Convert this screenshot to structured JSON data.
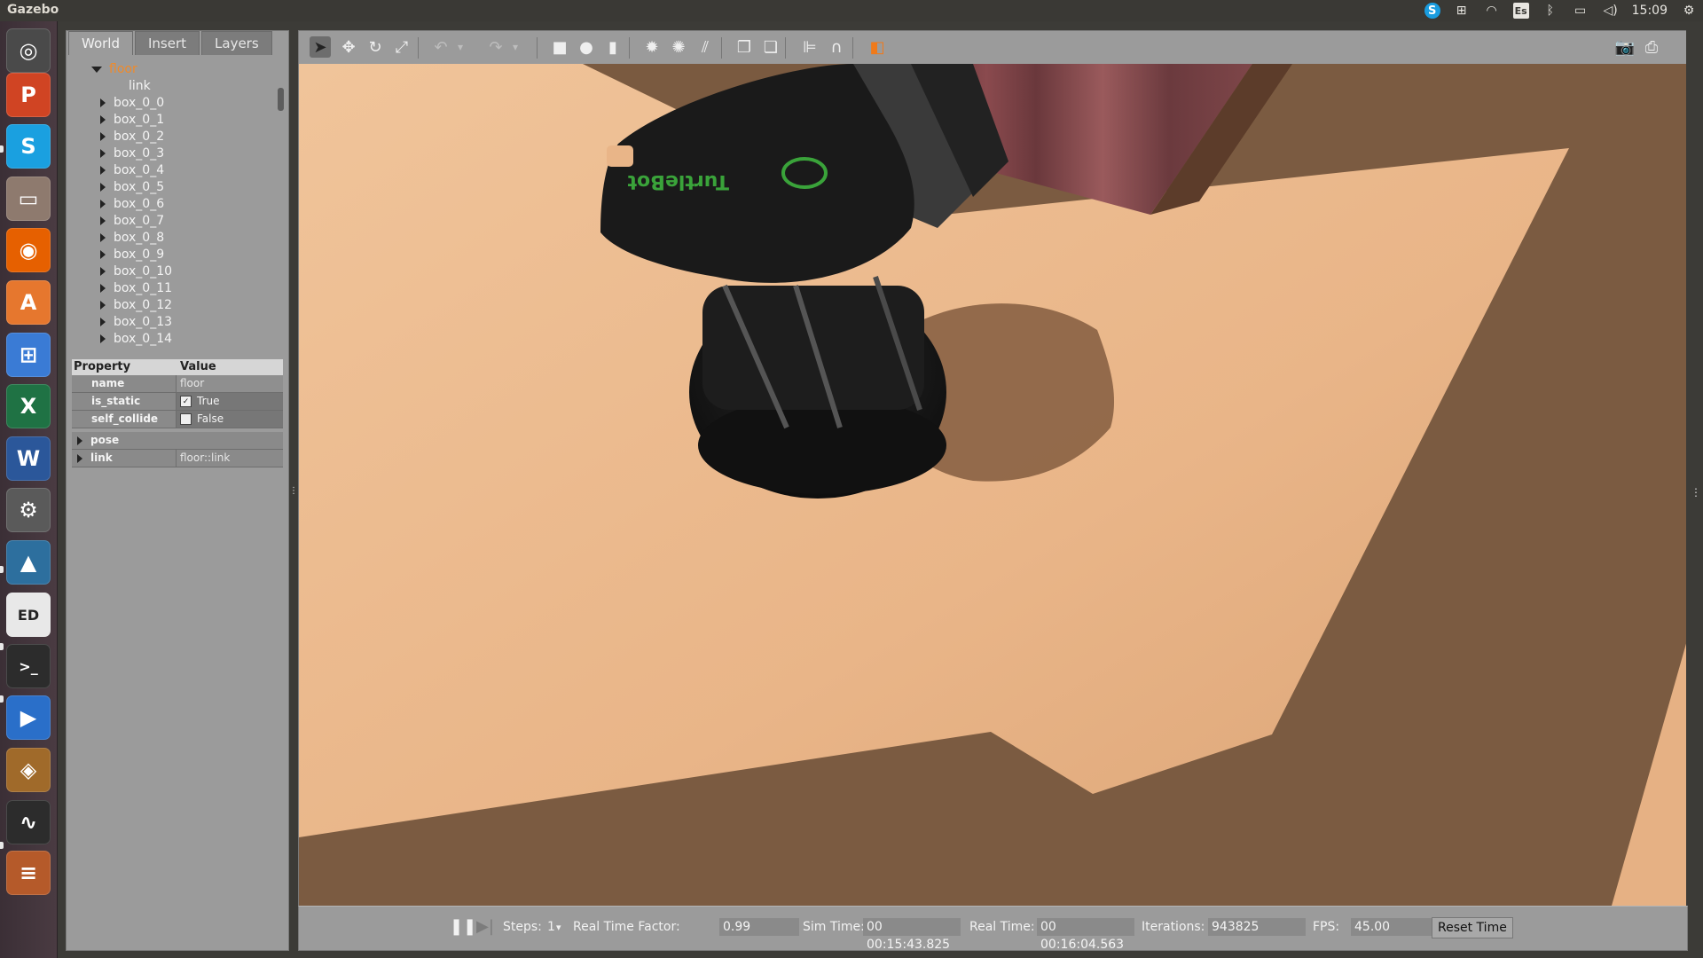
{
  "window": {
    "title": "Gazebo"
  },
  "system_tray": {
    "clock": "15:09",
    "keyboard_layout": "Es"
  },
  "launcher": {
    "apps": [
      {
        "name": "ubuntu-dash-icon",
        "glyph": "◎",
        "color": "#4a4a4a"
      },
      {
        "name": "powerpoint-icon",
        "glyph": "P",
        "color": "#d04423"
      },
      {
        "name": "skype-icon",
        "glyph": "S",
        "color": "#1aa0e0"
      },
      {
        "name": "files-icon",
        "glyph": "▭",
        "color": "#8e7a6e"
      },
      {
        "name": "firefox-icon",
        "glyph": "◉",
        "color": "#e66000"
      },
      {
        "name": "software-center-icon",
        "glyph": "A",
        "color": "#e6772e"
      },
      {
        "name": "windows-icon",
        "glyph": "⊞",
        "color": "#3a7bd5"
      },
      {
        "name": "excel-icon",
        "glyph": "X",
        "color": "#1f7244"
      },
      {
        "name": "word-icon",
        "glyph": "W",
        "color": "#2b579a"
      },
      {
        "name": "system-settings-icon",
        "glyph": "⚙",
        "color": "#5a5a5a"
      },
      {
        "name": "matlab-icon",
        "glyph": "▲",
        "color": "#2d6f9e"
      },
      {
        "name": "document-editor-icon",
        "glyph": "ED",
        "color": "#e8e8e8"
      },
      {
        "name": "terminal-icon",
        "glyph": ">_",
        "color": "#2c2c2c"
      },
      {
        "name": "media-player-icon",
        "glyph": "▶",
        "color": "#2a6fc9"
      },
      {
        "name": "virtualbox-icon",
        "glyph": "◈",
        "color": "#a06a2a"
      },
      {
        "name": "system-monitor-icon",
        "glyph": "∿",
        "color": "#2c2c2c"
      },
      {
        "name": "stacked-apps-icon",
        "glyph": "≡",
        "color": "#b55a2a"
      }
    ]
  },
  "left_panel": {
    "tabs": [
      "World",
      "Insert",
      "Layers"
    ],
    "tree": {
      "root": "floor",
      "root_child": "link",
      "items": [
        "box_0_0",
        "box_0_1",
        "box_0_2",
        "box_0_3",
        "box_0_4",
        "box_0_5",
        "box_0_6",
        "box_0_7",
        "box_0_8",
        "box_0_9",
        "box_0_10",
        "box_0_11",
        "box_0_12",
        "box_0_13",
        "box_0_14"
      ]
    },
    "properties": {
      "header_property": "Property",
      "header_value": "Value",
      "rows": [
        {
          "key": "name",
          "value": "floor",
          "type": "text"
        },
        {
          "key": "is_static",
          "value": "True",
          "type": "checkbox",
          "checked": true
        },
        {
          "key": "self_collide",
          "value": "False",
          "type": "checkbox",
          "checked": false
        }
      ],
      "expandable": [
        {
          "key": "pose",
          "value": ""
        },
        {
          "key": "link",
          "value": "floor::link"
        }
      ]
    }
  },
  "toolbar": {
    "tools": [
      {
        "name": "select-mode-icon",
        "glyph": "➤"
      },
      {
        "name": "translate-mode-icon",
        "glyph": "✥"
      },
      {
        "name": "rotate-mode-icon",
        "glyph": "↻"
      },
      {
        "name": "scale-mode-icon",
        "glyph": "⤢"
      },
      {
        "name": "undo-icon",
        "glyph": "↶"
      },
      {
        "name": "undo-history-icon",
        "glyph": "▾"
      },
      {
        "name": "redo-icon",
        "glyph": "↷"
      },
      {
        "name": "redo-history-icon",
        "glyph": "▾"
      },
      {
        "name": "box-shape-icon",
        "glyph": "■"
      },
      {
        "name": "sphere-shape-icon",
        "glyph": "●"
      },
      {
        "name": "cylinder-shape-icon",
        "glyph": "▮"
      },
      {
        "name": "point-light-icon",
        "glyph": "✹"
      },
      {
        "name": "spot-light-icon",
        "glyph": "✺"
      },
      {
        "name": "directional-light-icon",
        "glyph": "⫽"
      },
      {
        "name": "copy-icon",
        "glyph": "❐"
      },
      {
        "name": "paste-icon",
        "glyph": "❏"
      },
      {
        "name": "align-icon",
        "glyph": "⊫"
      },
      {
        "name": "snap-icon",
        "glyph": "∩"
      },
      {
        "name": "change-view-icon",
        "glyph": "◧"
      },
      {
        "name": "screenshot-icon",
        "glyph": "📷"
      },
      {
        "name": "log-data-icon",
        "glyph": "⎙"
      }
    ]
  },
  "viewport": {
    "robot_logo_text": "TurtleBot"
  },
  "bottom_bar": {
    "steps_label": "Steps:",
    "steps_value": "1",
    "rtf_label": "Real Time Factor:",
    "rtf_value": "0.99",
    "sim_time_label": "Sim Time:",
    "sim_time_value": "00 00:15:43.825",
    "real_time_label": "Real Time:",
    "real_time_value": "00 00:16:04.563",
    "iterations_label": "Iterations:",
    "iterations_value": "943825",
    "fps_label": "FPS:",
    "fps_value": "45.00",
    "reset_time_label": "Reset Time"
  }
}
